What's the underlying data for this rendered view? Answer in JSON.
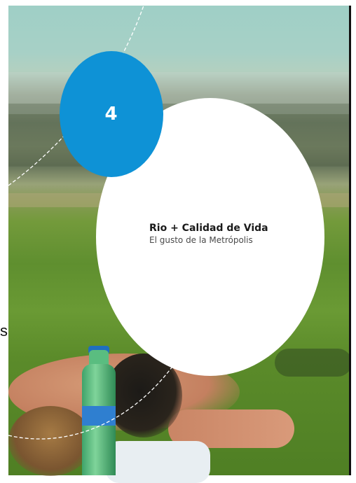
{
  "badge": {
    "number": "4"
  },
  "caption": {
    "title": "Rio + Calidad de Vida",
    "subtitle": "El gusto de la Metrópolis"
  },
  "margin_text": "s",
  "colors": {
    "badge_blue": "#0e92d6",
    "caption_circle": "#ffffff",
    "page_rule": "#111111"
  },
  "photo": {
    "scene": "people-lying-on-grass",
    "objects": [
      "water-bottle-icon"
    ]
  }
}
